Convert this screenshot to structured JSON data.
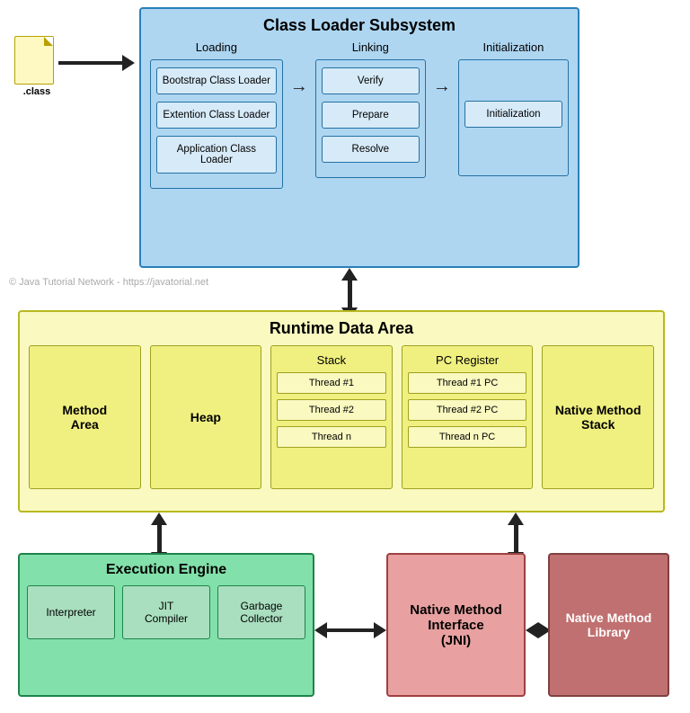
{
  "classLoaderSubsystem": {
    "title": "Class Loader Subsystem",
    "sections": {
      "loading": {
        "label": "Loading",
        "boxes": [
          "Bootstrap Class Loader",
          "Extention Class Loader",
          "Application Class Loader"
        ]
      },
      "linking": {
        "label": "Linking",
        "boxes": [
          "Verify",
          "Prepare",
          "Resolve"
        ]
      },
      "initialization": {
        "label": "Initialization",
        "box": "Initialization"
      }
    }
  },
  "classFile": {
    "label": ".class"
  },
  "watermark": "© Java Tutorial Network - https://javatorial.net",
  "runtimeDataArea": {
    "title": "Runtime Data Area",
    "methodArea": "Method\nArea",
    "heap": "Heap",
    "stack": {
      "title": "Stack",
      "threads": [
        "Thread #1",
        "Thread #2",
        "Thread n"
      ]
    },
    "pcRegister": {
      "title": "PC Register",
      "threads": [
        "Thread #1 PC",
        "Thread #2 PC",
        "Thread n PC"
      ]
    },
    "nativeMethodStack": "Native Method\nStack"
  },
  "executionEngine": {
    "title": "Execution Engine",
    "boxes": [
      "Interpreter",
      "JIT\nCompiler",
      "Garbage\nCollector"
    ]
  },
  "nativeMethodInterface": {
    "title": "Native Method\nInterface\n(JNI)"
  },
  "nativeMethodLibrary": {
    "title": "Native Method\nLibrary"
  }
}
